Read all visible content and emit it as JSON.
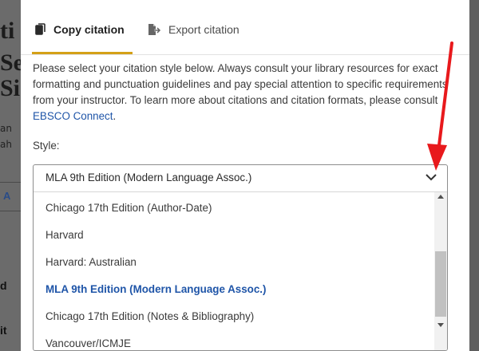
{
  "background": {
    "fragments": [
      "ti",
      "Se",
      "Si"
    ],
    "small_texts": [
      "an",
      "ah"
    ],
    "link_fragment": "A",
    "bold_fragments": [
      "d",
      "it"
    ]
  },
  "tabs": [
    {
      "label": "Copy citation",
      "icon": "copy-icon",
      "active": true
    },
    {
      "label": "Export citation",
      "icon": "export-icon",
      "active": false
    }
  ],
  "instructions": {
    "text": "Please select your citation style below. Always consult your library resources for exact formatting and punctuation guidelines and pay special attention to specific requirements from your instructor. To learn more about citations and citation formats, please consult ",
    "link_label": "EBSCO Connect",
    "suffix": "."
  },
  "style_label": "Style:",
  "select": {
    "selected": "MLA 9th Edition (Modern Language Assoc.)",
    "options": [
      "Chicago 17th Edition (Author-Date)",
      "Harvard",
      "Harvard: Australian",
      "MLA 9th Edition (Modern Language Assoc.)",
      "Chicago 17th Edition (Notes & Bibliography)",
      "Vancouver/ICMJE"
    ],
    "active_index": 3,
    "scroll_position": 0.6
  },
  "colors": {
    "accent_tab": "#d4a017",
    "link": "#1f55a8",
    "annotation_arrow": "#e8191c"
  }
}
